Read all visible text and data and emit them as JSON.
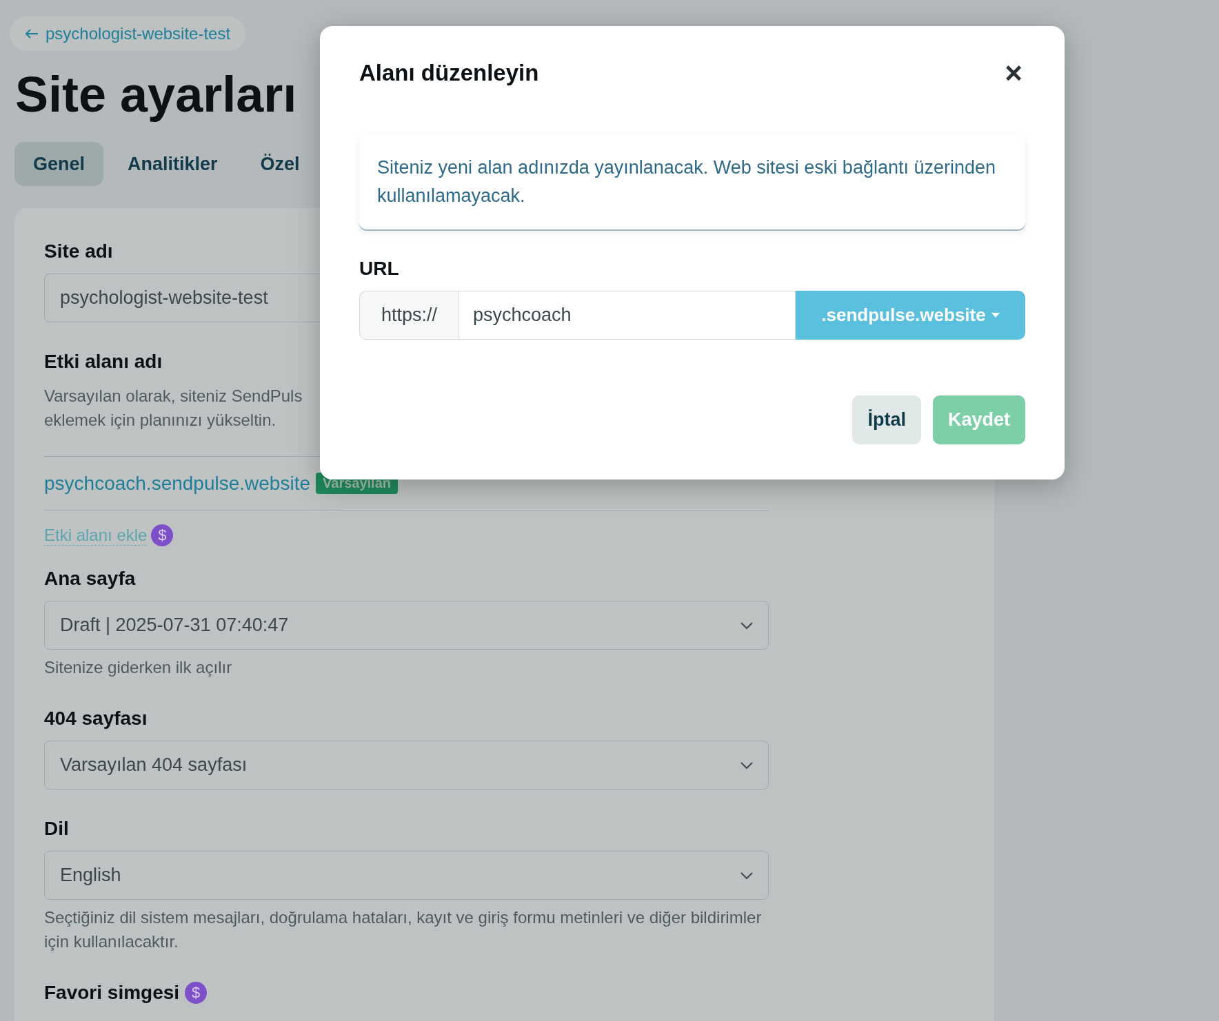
{
  "back_link": {
    "label": "psychologist-website-test"
  },
  "page_title": "Site ayarları",
  "tabs": [
    {
      "label": "Genel",
      "selected": true
    },
    {
      "label": "Analitikler",
      "selected": false
    },
    {
      "label": "Özel",
      "selected": false
    }
  ],
  "sections": [
    {
      "kind": "text",
      "label": "Site adı",
      "value": "psychologist-website-test"
    },
    {
      "kind": "domain",
      "label": "Etki alanı adı",
      "description": [
        "Varsayılan olarak, siteniz SendPuls",
        "eklemek için planınızı yükseltin."
      ],
      "domains": [
        {
          "url": "psychcoach.sendpulse.website",
          "badge": "Varsayılan"
        }
      ],
      "add_link": "Etki alanı ekle",
      "pro_mark": "$"
    },
    {
      "kind": "select",
      "label": "Ana sayfa",
      "value": "Draft | 2025-07-31 07:40:47",
      "hint": "Sitenize giderken ilk açılır"
    },
    {
      "kind": "select",
      "label": "404 sayfası",
      "value": "Varsayılan 404 sayfası"
    },
    {
      "kind": "select",
      "label": "Dil",
      "value": "English",
      "hint": "Seçtiğiniz dil sistem mesajları, doğrulama hataları, kayıt ve giriş formu metinleri ve diğer bildirimler için kullanılacaktır."
    },
    {
      "kind": "heading",
      "label": "Favori simgesi",
      "pro_mark": "$"
    }
  ],
  "modal": {
    "title": "Alanı düzenleyin",
    "close": "×",
    "notice": "Siteniz yeni alan adınızda yayınlanacak. Web sitesi eski bağlantı üzerinden kullanılamayacak.",
    "url_label": "URL",
    "prefix": "https://",
    "value": "psychcoach",
    "suffix": ".sendpulse.website",
    "buttons": [
      {
        "kind": "secondary",
        "label": "İptal"
      },
      {
        "kind": "primary",
        "label": "Kaydet"
      }
    ]
  }
}
